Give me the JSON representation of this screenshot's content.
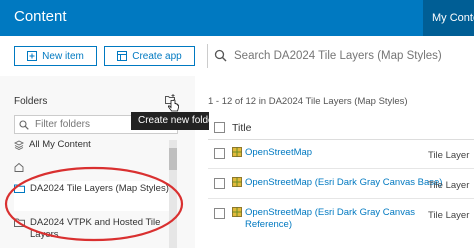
{
  "header": {
    "title": "Content",
    "my_content_tab": "My Content"
  },
  "toolbar": {
    "new_item_label": "New item",
    "create_app_label": "Create app",
    "search_placeholder": "Search DA2024 Tile Layers (Map Styles)"
  },
  "sidebar": {
    "folders_label": "Folders",
    "new_folder_tooltip": "Create new folder",
    "filter_placeholder": "Filter folders",
    "folders": [
      {
        "label": "All My Content",
        "icon": "stack-icon"
      },
      {
        "label": "",
        "icon": "home-icon"
      },
      {
        "label": "DA2024 Tile Layers (Map Styles)",
        "icon": "folder-icon",
        "selected": true
      },
      {
        "label": "DA2024 VTPK and Hosted Tile Layers",
        "icon": "folder-icon"
      }
    ]
  },
  "results": {
    "range_text": "1 - 12 of 12 in DA2024 Tile Layers (Map Styles)",
    "title_header": "Title",
    "items": [
      {
        "title": "OpenStreetMap",
        "type": "Tile Layer",
        "icon": "tile-layer-icon"
      },
      {
        "title": "OpenStreetMap (Esri Dark Gray Canvas Base)",
        "type": "Tile Layer",
        "icon": "tile-layer-icon"
      },
      {
        "title": "OpenStreetMap (Esri Dark Gray Canvas Reference)",
        "type": "Tile Layer",
        "icon": "tile-layer-icon"
      }
    ]
  },
  "colors": {
    "brand": "#0079c1",
    "tab_active": "#005e95",
    "annotation": "#d93030"
  }
}
